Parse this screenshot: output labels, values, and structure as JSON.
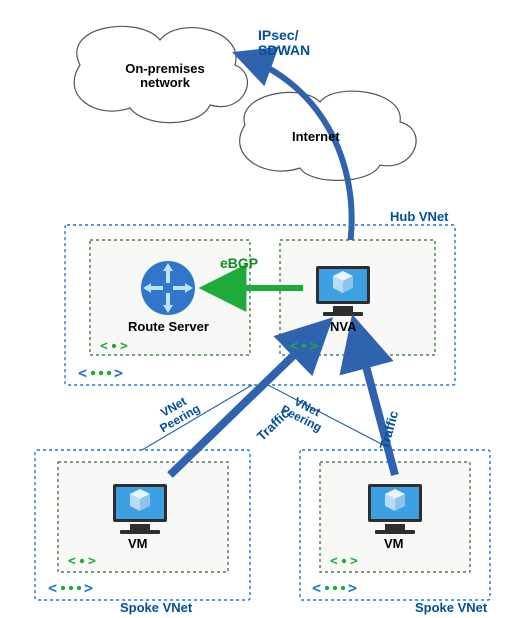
{
  "clouds": {
    "onprem": "On-premises\nnetwork",
    "internet": "Internet"
  },
  "hub": {
    "label": "Hub VNet",
    "route_server": "Route Server",
    "nva": "NVA"
  },
  "spokes": {
    "left": {
      "label": "Spoke VNet",
      "vm": "VM"
    },
    "right": {
      "label": "Spoke VNet",
      "vm": "VM"
    }
  },
  "edges": {
    "ipsec": "IPsec/\nSDWAN",
    "ebgp": "eBGP",
    "peering": "VNet\nPeering",
    "traffic": "Traffic"
  },
  "colors": {
    "blue": "#2f63ad",
    "blue_dark": "#004f9b",
    "green": "#108a24",
    "green_dark": "#2a6a2a",
    "azure": "#3da0e2",
    "grey": "#808080",
    "fill": "#f2f2f2"
  }
}
